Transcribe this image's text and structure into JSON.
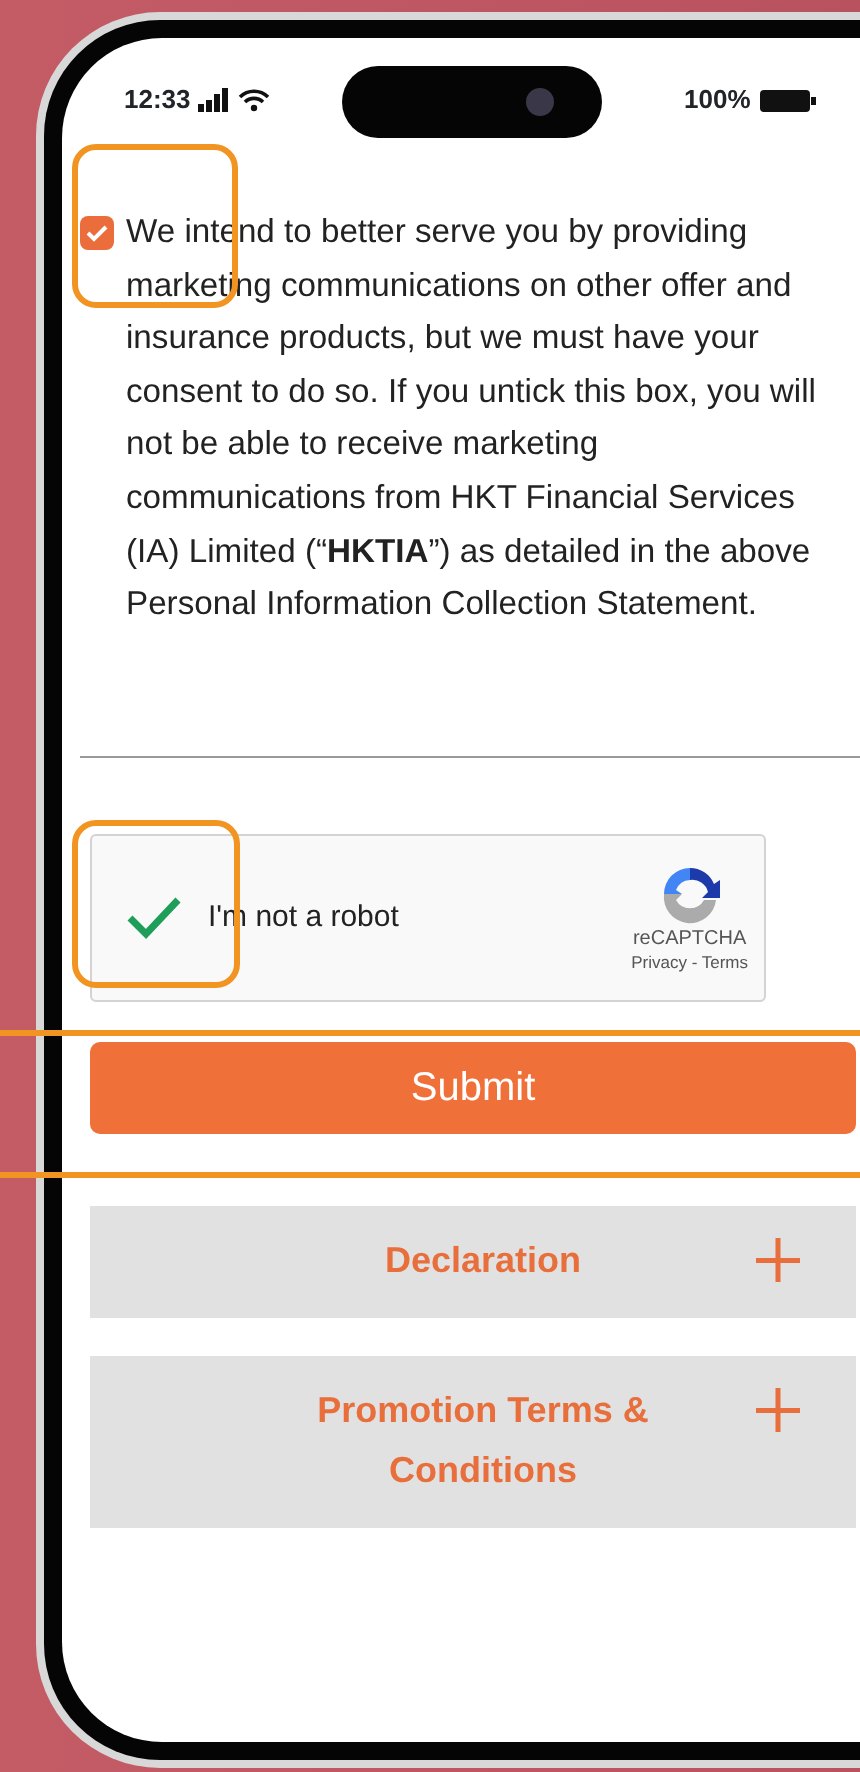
{
  "status_bar": {
    "time": "12:33",
    "battery": "100%"
  },
  "consent": {
    "checked": true,
    "text": "We intend to better serve you by providing marketing communications on other offer and insurance products, but we must have your consent to do so. If you untick this box, you will not be able to receive marketing communications from HKT Financial Services (IA) Limited (“**HKTIA**”) as detailed in the above Personal Information Collection Statement."
  },
  "recaptcha": {
    "checked": true,
    "label": "I'm not a robot",
    "brand": "reCAPTCHA",
    "links": "Privacy - Terms"
  },
  "submit": "Submit",
  "sections": [
    {
      "title": "Declaration",
      "expanded": false
    },
    {
      "title": "Promotion Terms & Conditions",
      "expanded": false
    }
  ]
}
